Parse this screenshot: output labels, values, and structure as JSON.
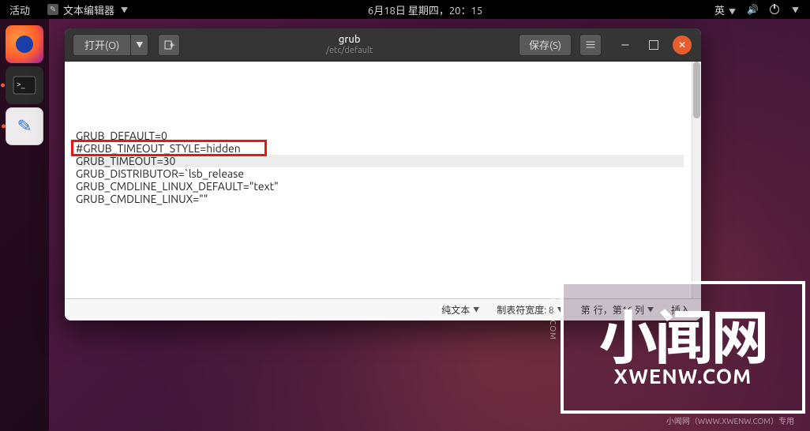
{
  "panel": {
    "activities": "活动",
    "app_name": "文本编辑器",
    "datetime": "6月18日 星期四，20：15",
    "ime": "英"
  },
  "window": {
    "open_label": "打开(O)",
    "title_filename": "grub",
    "title_path": "/etc/default",
    "save_label": "保存(S)"
  },
  "editor": {
    "lines": [
      "",
      "",
      "",
      "",
      "",
      "GRUB_DEFAULT=0",
      "#GRUB_TIMEOUT_STYLE=hidden",
      "GRUB_TIMEOUT=30",
      "GRUB_DISTRIBUTOR=`lsb_release",
      "GRUB_CMDLINE_LINUX_DEFAULT=\"text\"",
      "GRUB_CMDLINE_LINUX=\"\""
    ],
    "cursor_line_index": 7
  },
  "statusbar": {
    "syntax": "纯文本",
    "tab_width": "制表符宽度: 8",
    "cursor_pos_prefix": "第",
    "cursor_pos_mid": "行，第16 列",
    "insert_mode": "插入"
  },
  "watermark": {
    "big": "小闻网",
    "url": "XWENW.COM",
    "side": "XWENW.COM",
    "foot": "小闻网（WWW.XWENW.COM）专用"
  }
}
